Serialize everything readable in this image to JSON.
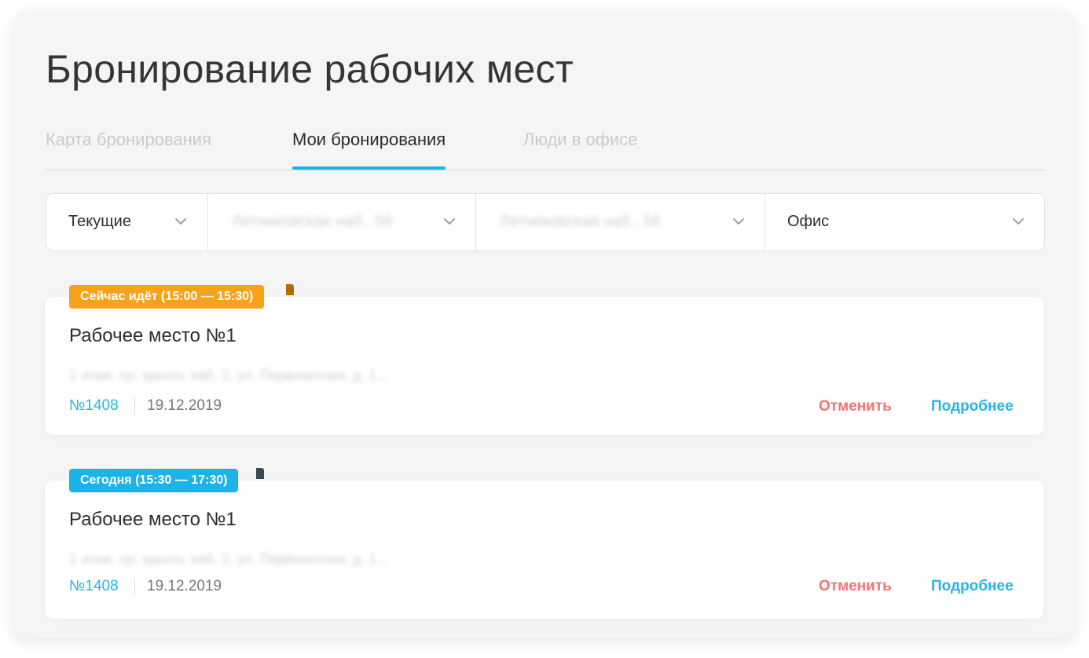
{
  "page": {
    "title": "Бронирование рабочих мест"
  },
  "tabs": [
    {
      "label": "Карта бронирования",
      "active": false
    },
    {
      "label": "Мои бронирования",
      "active": true
    },
    {
      "label": "Люди в офисе",
      "active": false
    }
  ],
  "filters": [
    {
      "value": "Текущие",
      "blurred": false
    },
    {
      "value": "Летниковская наб., 56",
      "blurred": true
    },
    {
      "value": "Летниковская наб., 56",
      "blurred": true
    },
    {
      "value": "Офис",
      "blurred": false
    }
  ],
  "bookings": [
    {
      "tag": "Сейчас идёт (15:00 — 15:30)",
      "tag_color": "#f7a21b",
      "tag_fold_color": "#b36b00",
      "place": "Рабочее место №1",
      "address": "1 этаж, пр. крыло, каб. 2, ул. Первокитная, д. 1...",
      "number": "№1408",
      "date": "19.12.2019",
      "cancel_label": "Отменить",
      "more_label": "Подробнее"
    },
    {
      "tag": "Сегодня (15:30 — 17:30)",
      "tag_color": "#1ab4e8",
      "tag_fold_color": "#3a4a55",
      "place": "Рабочее место №1",
      "address": "1 этаж, пр. крыло, каб. 2, ул. Первокитная, д. 1...",
      "number": "№1408",
      "date": "19.12.2019",
      "cancel_label": "Отменить",
      "more_label": "Подробнее"
    }
  ]
}
